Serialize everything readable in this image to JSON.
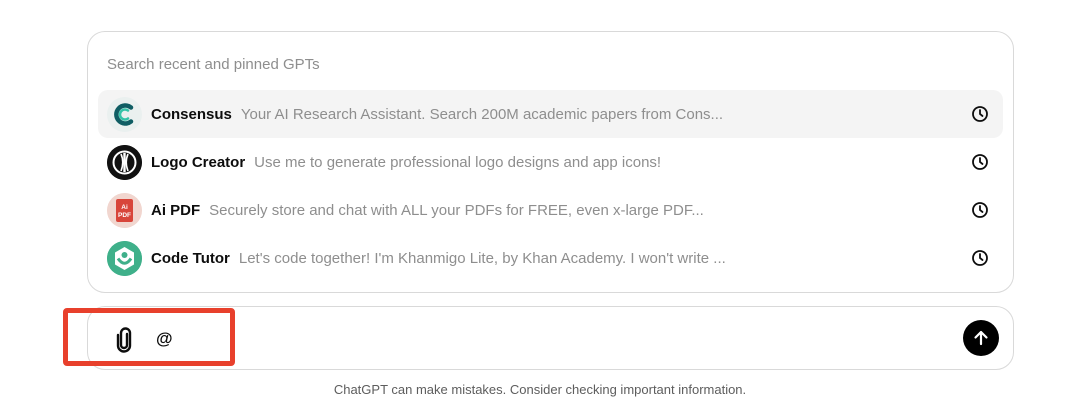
{
  "popup": {
    "header": "Search recent and pinned GPTs",
    "items": [
      {
        "name": "Consensus",
        "description": "Your AI Research Assistant. Search 200M academic papers from Cons...",
        "icon": "consensus-logo-icon"
      },
      {
        "name": "Logo Creator",
        "description": "Use me to generate professional logo designs and app icons!",
        "icon": "logo-creator-icon"
      },
      {
        "name": "Ai PDF",
        "description": "Securely store and chat with ALL your PDFs for FREE, even x-large PDF...",
        "icon": "ai-pdf-icon"
      },
      {
        "name": "Code Tutor",
        "description": "Let's code together! I'm Khanmigo Lite, by Khan Academy. I won't write ...",
        "icon": "khan-academy-icon"
      }
    ],
    "recent_icon": "clock-icon"
  },
  "composer": {
    "attach_icon": "paperclip-icon",
    "mention_text": "@",
    "send_icon": "arrow-up-icon"
  },
  "highlight_color": "#e8402c",
  "pdf_icon_text": "Ai PDF",
  "disclaimer": "ChatGPT can make mistakes. Consider checking important information."
}
